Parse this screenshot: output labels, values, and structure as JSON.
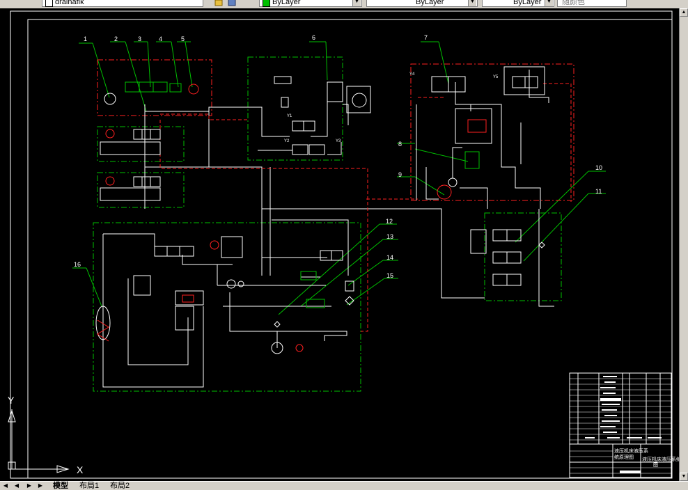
{
  "toolbar": {
    "layer_field": "drainafik",
    "color_field": "ByLayer",
    "linetype_field": "ByLayer",
    "lineweight_field": "ByLayer",
    "plotstyle_field": "随颜色"
  },
  "drawing": {
    "callouts": [
      "1",
      "2",
      "3",
      "4",
      "5",
      "6",
      "7",
      "8",
      "9",
      "10",
      "11",
      "12",
      "13",
      "14",
      "15",
      "16"
    ],
    "valve_tags": {
      "y1": "Y1",
      "y2": "Y2",
      "y3": "Y3",
      "y4": "Y4",
      "y5": "Y5"
    },
    "title_block": {
      "name_line1": "液压机床液压系",
      "name_line2": "统原理图",
      "drawing_title": "液压机床液压系统",
      "drawing_title2": "图"
    }
  },
  "ucs": {
    "x_label": "X",
    "y_label": "Y"
  },
  "status": {
    "tabs": [
      "模型",
      "布局1",
      "布局2"
    ],
    "nav_first": "◀",
    "nav_prev": "◀",
    "nav_next": "▶",
    "nav_last": "▶"
  },
  "colors": {
    "background": "#000000",
    "line_white": "#ffffff",
    "line_red": "#ff2020",
    "line_green": "#00c000",
    "chrome": "#d4d0c8"
  }
}
